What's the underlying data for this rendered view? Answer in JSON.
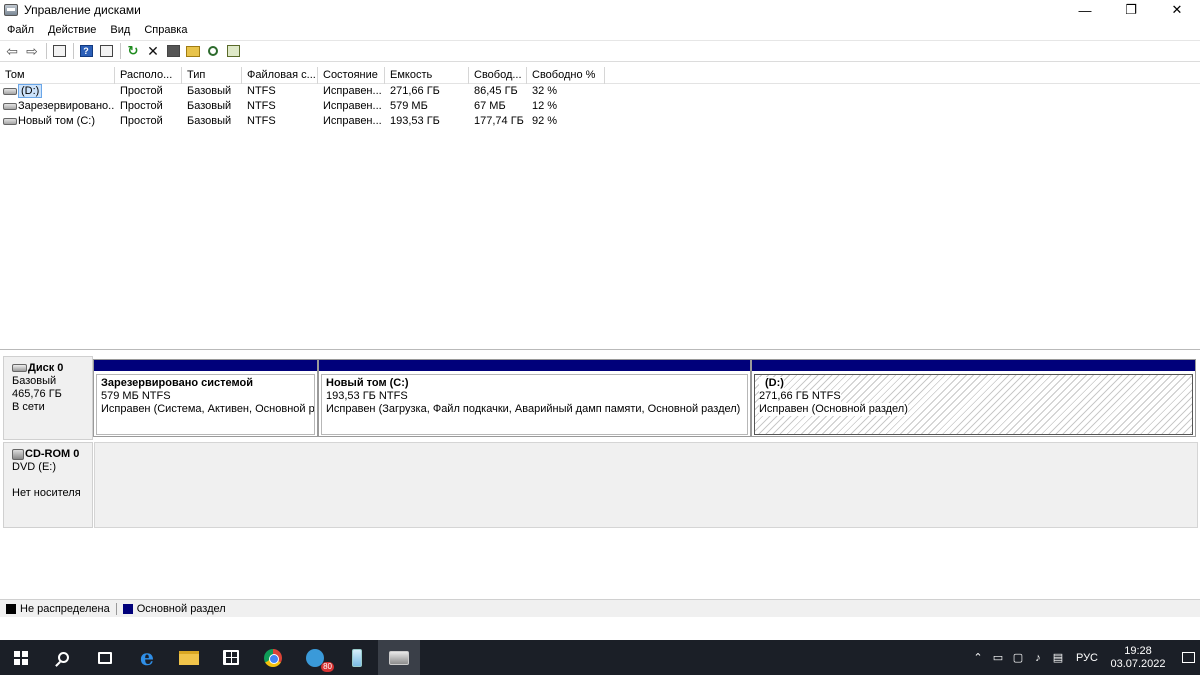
{
  "window": {
    "title": "Управление дисками",
    "minimize_glyph": "—",
    "restore_glyph": "❐",
    "close_glyph": "✕"
  },
  "menu": [
    "Файл",
    "Действие",
    "Вид",
    "Справка"
  ],
  "toolbar": {
    "icons": [
      "back-arrow-icon",
      "forward-arrow-icon",
      "console-tree-icon",
      "help-icon",
      "properties-icon",
      "refresh-icon",
      "delete-icon",
      "settings-icon",
      "open-folder-icon",
      "search-icon",
      "export-list-icon"
    ],
    "back_glyph": "⇦",
    "forward_glyph": "⇨",
    "help_glyph": "?",
    "refresh_glyph": "↻",
    "delete_glyph": "✕"
  },
  "volumes": {
    "columns": [
      "Том",
      "Располо...",
      "Тип",
      "Файловая с...",
      "Состояние",
      "Емкость",
      "Свобод...",
      "Свободно %"
    ],
    "rows": [
      {
        "name": "(D:)",
        "layout": "Простой",
        "type": "Базовый",
        "fs": "NTFS",
        "status": "Исправен...",
        "capacity": "271,66 ГБ",
        "free": "86,45 ГБ",
        "free_pct": "32 %",
        "selected": true
      },
      {
        "name": "Зарезервировано...",
        "layout": "Простой",
        "type": "Базовый",
        "fs": "NTFS",
        "status": "Исправен...",
        "capacity": "579 МБ",
        "free": "67 МБ",
        "free_pct": "12 %",
        "selected": false
      },
      {
        "name": "Новый том (C:)",
        "layout": "Простой",
        "type": "Базовый",
        "fs": "NTFS",
        "status": "Исправен...",
        "capacity": "193,53 ГБ",
        "free": "177,74 ГБ",
        "free_pct": "92 %",
        "selected": false
      }
    ]
  },
  "disks": [
    {
      "name": "Диск 0",
      "kind": "Базовый",
      "size": "465,76 ГБ",
      "state": "В сети",
      "partitions": [
        {
          "title": "Зарезервировано системой",
          "size_fs": "579 МБ NTFS",
          "status": "Исправен (Система, Активен, Основной раз"
        },
        {
          "title": "Новый том  (C:)",
          "size_fs": "193,53 ГБ NTFS",
          "status": "Исправен (Загрузка, Файл подкачки, Аварийный дамп памяти, Основной раздел)"
        },
        {
          "title": "(D:)",
          "size_fs": "271,66 ГБ NTFS",
          "status": "Исправен (Основной раздел)"
        }
      ]
    },
    {
      "name": "CD-ROM 0",
      "kind": "DVD (E:)",
      "state": "Нет носителя"
    }
  ],
  "legend": [
    {
      "label": "Не распределена",
      "color": "#000000"
    },
    {
      "label": "Основной раздел",
      "color": "#00007a"
    }
  ],
  "taskbar": {
    "apps": [
      "start-icon",
      "search-icon",
      "task-view-icon",
      "edge-icon",
      "file-explorer-icon",
      "store-icon",
      "chrome-icon",
      "telegram-icon",
      "bottle-app-icon",
      "disk-management-icon"
    ],
    "telegram_badge": "80",
    "tray": {
      "chevron": "⌃",
      "language": "РУС",
      "time": "19:28",
      "date": "03.07.2022"
    }
  }
}
